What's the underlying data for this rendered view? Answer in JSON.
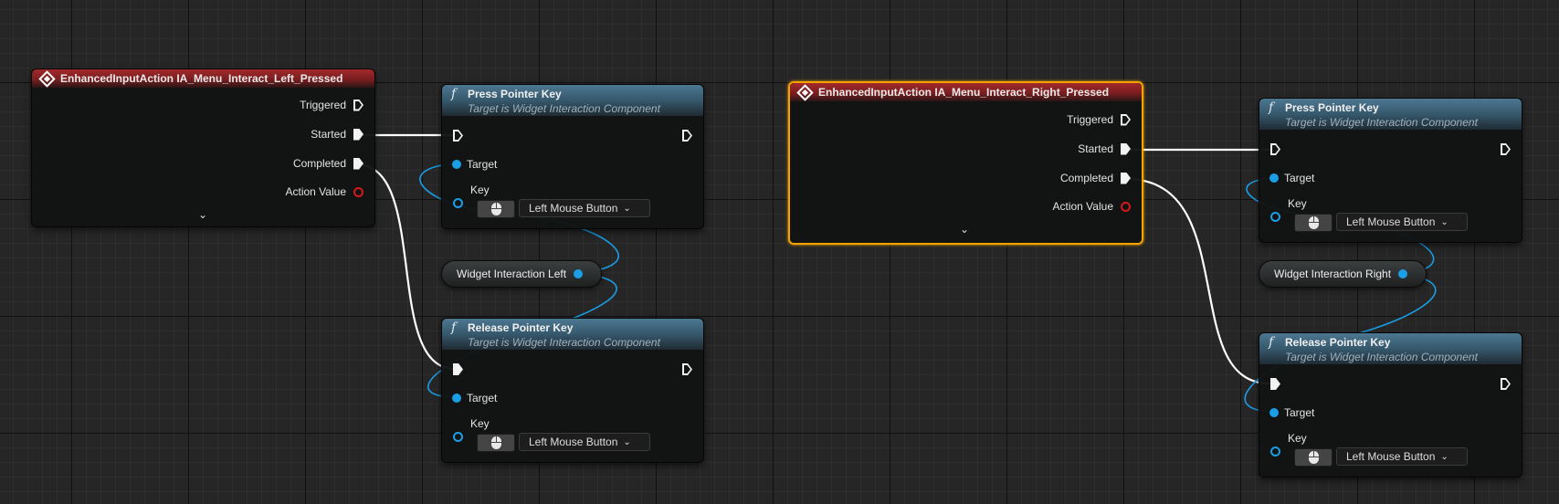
{
  "nodes": {
    "left_event": {
      "title": "EnhancedInputAction IA_Menu_Interact_Left_Pressed",
      "pins": [
        "Triggered",
        "Started",
        "Completed",
        "Action Value"
      ]
    },
    "right_event": {
      "title": "EnhancedInputAction IA_Menu_Interact_Right_Pressed",
      "pins": [
        "Triggered",
        "Started",
        "Completed",
        "Action Value"
      ]
    },
    "press_left": {
      "title": "Press Pointer Key",
      "subtitle": "Target is Widget Interaction Component",
      "target_label": "Target",
      "key_label": "Key",
      "key_value": "Left Mouse Button"
    },
    "release_left": {
      "title": "Release Pointer Key",
      "subtitle": "Target is Widget Interaction Component",
      "target_label": "Target",
      "key_label": "Key",
      "key_value": "Left Mouse Button"
    },
    "press_right": {
      "title": "Press Pointer Key",
      "subtitle": "Target is Widget Interaction Component",
      "target_label": "Target",
      "key_label": "Key",
      "key_value": "Left Mouse Button"
    },
    "release_right": {
      "title": "Release Pointer Key",
      "subtitle": "Target is Widget Interaction Component",
      "target_label": "Target",
      "key_label": "Key",
      "key_value": "Left Mouse Button"
    },
    "var_left": {
      "label": "Widget Interaction Left"
    },
    "var_right": {
      "label": "Widget Interaction Right"
    }
  },
  "colors": {
    "event_header": "#a2292a",
    "function_header": "#4c7791",
    "object_pin": "#1a9ee5",
    "struct_pin": "#d51919",
    "selection": "#f5a300",
    "exec_wire": "#ffffff"
  },
  "icons": {
    "event": "event-diamond-icon",
    "function": "function-f-icon",
    "expand": "chevron-down-icon",
    "mouse": "mouse-icon"
  },
  "selected_node": "right_event"
}
